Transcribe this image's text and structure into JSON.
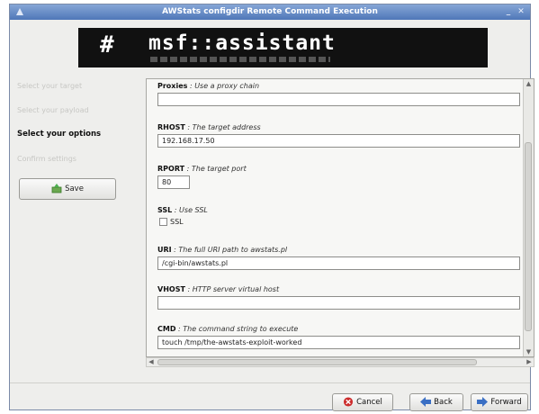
{
  "window": {
    "title": "AWStats configdir Remote Command Execution"
  },
  "banner": {
    "hash": "#",
    "logo": "msf::assistant"
  },
  "steps": [
    {
      "label": "Select your target",
      "active": false
    },
    {
      "label": "Select your payload",
      "active": false
    },
    {
      "label": "Select your options",
      "active": true
    },
    {
      "label": "Confirm settings",
      "active": false
    }
  ],
  "save_label": "Save",
  "options": {
    "proxies": {
      "name": "Proxies",
      "desc": "Use a proxy chain",
      "value": ""
    },
    "rhost": {
      "name": "RHOST",
      "desc": "The target address",
      "value": "192.168.17.50"
    },
    "rport": {
      "name": "RPORT",
      "desc": "The target port",
      "value": "80"
    },
    "ssl": {
      "name": "SSL",
      "desc": "Use SSL",
      "checkbox_label": "SSL",
      "checked": false
    },
    "uri": {
      "name": "URI",
      "desc": "The full URI path to awstats.pl",
      "value": "/cgi-bin/awstats.pl"
    },
    "vhost": {
      "name": "VHOST",
      "desc": "HTTP server virtual host",
      "value": ""
    },
    "cmd": {
      "name": "CMD",
      "desc": "The command string to execute",
      "value": "touch /tmp/the-awstats-exploit-worked"
    }
  },
  "buttons": {
    "cancel": "Cancel",
    "back": "Back",
    "forward": "Forward"
  },
  "colors": {
    "titlebar": "#4f77b8",
    "cancel_icon": "#cc2b2b",
    "nav_icon": "#3a6fc4"
  }
}
